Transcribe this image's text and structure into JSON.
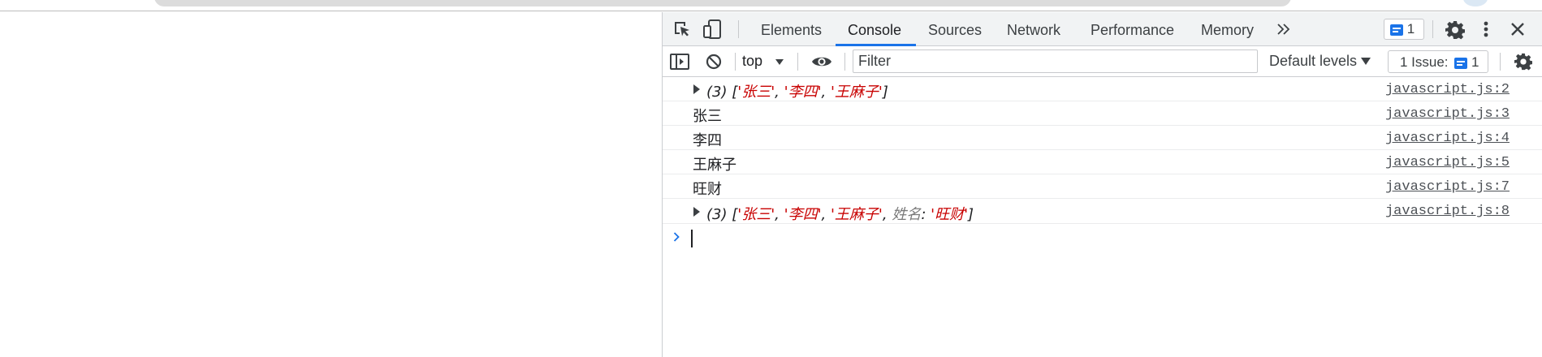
{
  "devtools": {
    "tabs": [
      "Elements",
      "Console",
      "Sources",
      "Network",
      "Performance",
      "Memory"
    ],
    "active_tab": "Console",
    "more_tabs_icon": "chevron-double-right",
    "issues_badge_count": "1",
    "colors": {
      "accent": "#1a73e8",
      "string": "#c80000"
    }
  },
  "console_toolbar": {
    "context": "top",
    "filter_placeholder": "Filter",
    "levels": "Default levels",
    "issues_label": "1 Issue:",
    "issues_count": "1"
  },
  "console": {
    "rows": [
      {
        "type": "array",
        "count": "(3)",
        "open": "[",
        "items": [
          "'张三'",
          "'李四'",
          "'王麻子'"
        ],
        "close": "]",
        "source": "javascript.js:2"
      },
      {
        "type": "text",
        "text": "张三",
        "source": "javascript.js:3"
      },
      {
        "type": "text",
        "text": "李四",
        "source": "javascript.js:4"
      },
      {
        "type": "text",
        "text": "王麻子",
        "source": "javascript.js:5"
      },
      {
        "type": "text",
        "text": "旺财",
        "source": "javascript.js:7"
      },
      {
        "type": "array",
        "count": "(3)",
        "open": "[",
        "items": [
          "'张三'",
          "'李四'",
          "'王麻子'"
        ],
        "extra_key": "姓名",
        "extra_value": "'旺财'",
        "close": "]",
        "source": "javascript.js:8"
      }
    ]
  }
}
